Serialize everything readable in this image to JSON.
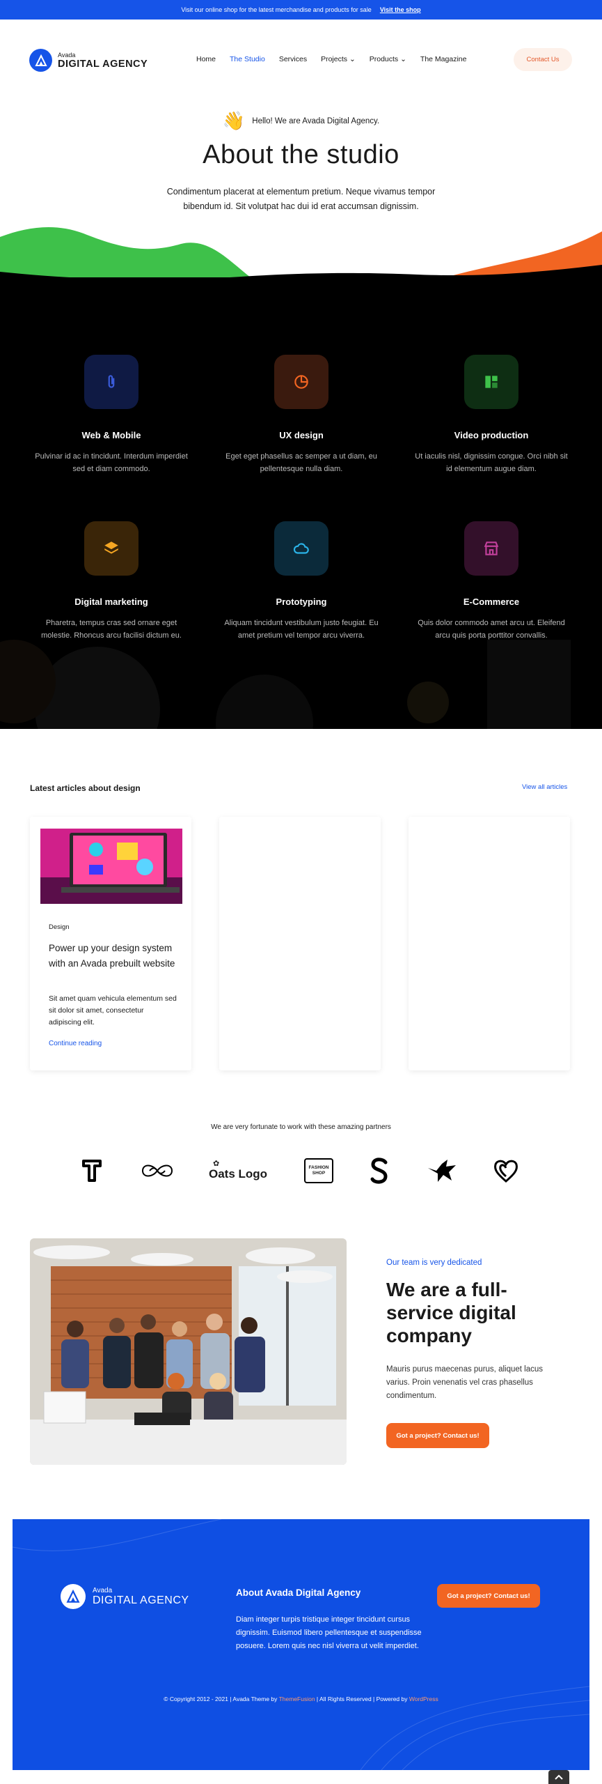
{
  "topbar": {
    "text": "Visit our online shop for the latest merchandise and products for sale",
    "link": "Visit the shop"
  },
  "header": {
    "logo_small": "Avada",
    "logo_big": "DIGITAL AGENCY",
    "nav": [
      {
        "label": "Home"
      },
      {
        "label": "The Studio"
      },
      {
        "label": "Services"
      },
      {
        "label": "Projects"
      },
      {
        "label": "Products"
      },
      {
        "label": "The Magazine"
      }
    ],
    "contact": "Contact Us"
  },
  "hero": {
    "hello": "Hello! We are Avada Digital Agency.",
    "title": "About the studio",
    "text": "Condimentum placerat at elementum pretium. Neque vivamus tempor bibendum id. Sit volutpat hac dui id erat accumsan dignissim."
  },
  "services": [
    {
      "title": "Web & Mobile",
      "text": "Pulvinar id ac in tincidunt. Interdum imperdiet sed et diam commodo.",
      "icon": "paperclip-icon",
      "color": "#3a5bd9"
    },
    {
      "title": "UX design",
      "text": "Eget eget phasellus ac semper a ut diam, eu pellentesque nulla diam.",
      "icon": "pie-chart-icon",
      "color": "#f26522"
    },
    {
      "title": "Video production",
      "text": "Ut iaculis nisl, dignissim congue. Orci nibh sit id elementum augue diam.",
      "icon": "layout-icon",
      "color": "#3ec14a"
    },
    {
      "title": "Digital marketing",
      "text": "Pharetra, tempus cras sed ornare eget molestie. Rhoncus arcu facilisi dictum eu.",
      "icon": "layers-icon",
      "color": "#f5a623"
    },
    {
      "title": "Prototyping",
      "text": "Aliquam tincidunt vestibulum justo feugiat. Eu amet pretium vel tempor arcu viverra.",
      "icon": "cloud-icon",
      "color": "#2bb3e8"
    },
    {
      "title": "E-Commerce",
      "text": "Quis dolor commodo amet arcu ut. Eleifend arcu quis porta porttitor convallis.",
      "icon": "store-icon",
      "color": "#c2409b"
    }
  ],
  "articles": {
    "title": "Latest articles about design",
    "view_all": "View all articles",
    "card": {
      "category": "Design",
      "title": "Power up your design system with an Avada prebuilt website",
      "excerpt": "Sit amet quam vehicula elementum sed sit dolor sit amet, consectetur adipiscing elit.",
      "more": "Continue reading"
    }
  },
  "partners": {
    "text": "We are very fortunate to work with these amazing partners",
    "oats": "Oats Logo",
    "fashion_line1": "FASHION",
    "fashion_line2": "SHOP"
  },
  "team": {
    "subtitle": "Our team is very dedicated",
    "title": "We are a full-service digital company",
    "text": "Mauris purus maecenas purus, aliquet lacus varius. Proin venenatis vel cras phasellus condimentum.",
    "button": "Got a project? Contact us!"
  },
  "footer": {
    "logo_small": "Avada",
    "logo_big": "DIGITAL AGENCY",
    "about_title": "About Avada Digital Agency",
    "about_text": "Diam integer turpis tristique integer tincidunt cursus dignissim. Euismod libero pellentesque et suspendisse posuere. Lorem quis nec nisl viverra ut velit imperdiet.",
    "button": "Got a project? Contact us!",
    "copy_1": "© Copyright 2012 - 2021 | Avada Theme by ",
    "copy_link1": "ThemeFusion",
    "copy_2": " | All Rights Reserved | Powered by ",
    "copy_link2": "WordPress"
  },
  "colors": {
    "accent": "#1654e8",
    "orange": "#f26522",
    "green": "#3ec14a",
    "dark": "#000000"
  }
}
